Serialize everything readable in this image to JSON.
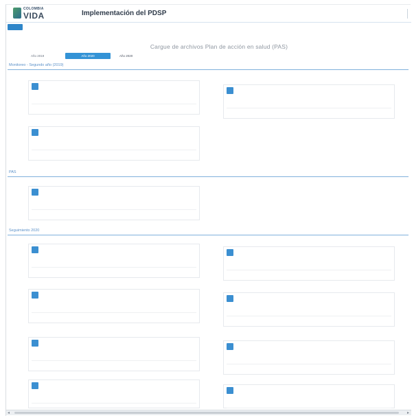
{
  "header": {
    "logo_top": "COLOMBIA",
    "logo_main": "VIDA",
    "app_title": "Implementación del PDSP",
    "user_name": "",
    "user_role": ""
  },
  "nav": {
    "home_label": ""
  },
  "page": {
    "title": "Cargue de archivos Plan de acción en salud (PAS)"
  },
  "year_tabs": [
    {
      "label": "Año 2019",
      "active": false
    },
    {
      "label": "Año 2020",
      "active": true
    },
    {
      "label": "Año 2020",
      "active": false
    }
  ],
  "sections": [
    {
      "title": "Monitoreo - Segundo año (2019)"
    },
    {
      "title": "PAS"
    },
    {
      "title": "Seguimiento 2020"
    }
  ],
  "cards": [
    {
      "badge": "",
      "line1": "",
      "line2": ""
    },
    {
      "badge": "",
      "line1": "",
      "line2": ""
    },
    {
      "badge": "",
      "line1": "",
      "line2": ""
    },
    {
      "badge": "",
      "line1": "",
      "line2": ""
    },
    {
      "badge": "",
      "line1": "",
      "line2": ""
    },
    {
      "badge": "",
      "line1": "",
      "line2": ""
    },
    {
      "badge": "",
      "line1": "",
      "line2": ""
    },
    {
      "badge": "",
      "line1": "",
      "line2": ""
    },
    {
      "badge": "",
      "line1": "",
      "line2": ""
    },
    {
      "badge": "",
      "line1": "",
      "line2": ""
    },
    {
      "badge": "",
      "line1": "",
      "line2": ""
    },
    {
      "badge": "",
      "line1": "",
      "line2": ""
    }
  ],
  "scrollbar": {
    "left_arrow_icon": "chevron-left-icon",
    "right_arrow_icon": "chevron-right-icon",
    "left_glyph": "◂",
    "right_glyph": "▸"
  },
  "colors": {
    "accent": "#3393d6",
    "section_title": "#5a90c8",
    "badge": "#3b8fd1"
  }
}
